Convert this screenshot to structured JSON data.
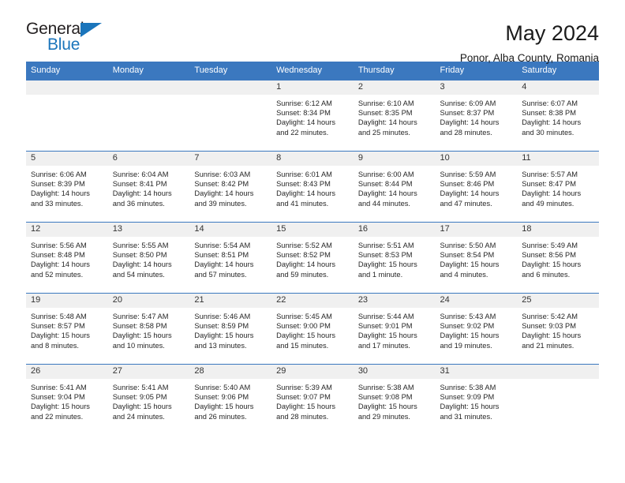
{
  "brand": {
    "name_top": "General",
    "name_bottom": "Blue",
    "accent_color": "#1b75bb"
  },
  "header": {
    "title": "May 2024",
    "subtitle": "Ponor, Alba County, Romania"
  },
  "theme": {
    "header_row_bg": "#3b78bf",
    "daynum_bg": "#f0f0f0",
    "grid_line": "#3b78bf",
    "text": "#262626"
  },
  "weekday_headers": [
    "Sunday",
    "Monday",
    "Tuesday",
    "Wednesday",
    "Thursday",
    "Friday",
    "Saturday"
  ],
  "weeks": [
    [
      {
        "day": "",
        "sunrise": "",
        "sunset": "",
        "daylight_line1": "",
        "daylight_line2": ""
      },
      {
        "day": "",
        "sunrise": "",
        "sunset": "",
        "daylight_line1": "",
        "daylight_line2": ""
      },
      {
        "day": "",
        "sunrise": "",
        "sunset": "",
        "daylight_line1": "",
        "daylight_line2": ""
      },
      {
        "day": "1",
        "sunrise": "Sunrise: 6:12 AM",
        "sunset": "Sunset: 8:34 PM",
        "daylight_line1": "Daylight: 14 hours",
        "daylight_line2": "and 22 minutes."
      },
      {
        "day": "2",
        "sunrise": "Sunrise: 6:10 AM",
        "sunset": "Sunset: 8:35 PM",
        "daylight_line1": "Daylight: 14 hours",
        "daylight_line2": "and 25 minutes."
      },
      {
        "day": "3",
        "sunrise": "Sunrise: 6:09 AM",
        "sunset": "Sunset: 8:37 PM",
        "daylight_line1": "Daylight: 14 hours",
        "daylight_line2": "and 28 minutes."
      },
      {
        "day": "4",
        "sunrise": "Sunrise: 6:07 AM",
        "sunset": "Sunset: 8:38 PM",
        "daylight_line1": "Daylight: 14 hours",
        "daylight_line2": "and 30 minutes."
      }
    ],
    [
      {
        "day": "5",
        "sunrise": "Sunrise: 6:06 AM",
        "sunset": "Sunset: 8:39 PM",
        "daylight_line1": "Daylight: 14 hours",
        "daylight_line2": "and 33 minutes."
      },
      {
        "day": "6",
        "sunrise": "Sunrise: 6:04 AM",
        "sunset": "Sunset: 8:41 PM",
        "daylight_line1": "Daylight: 14 hours",
        "daylight_line2": "and 36 minutes."
      },
      {
        "day": "7",
        "sunrise": "Sunrise: 6:03 AM",
        "sunset": "Sunset: 8:42 PM",
        "daylight_line1": "Daylight: 14 hours",
        "daylight_line2": "and 39 minutes."
      },
      {
        "day": "8",
        "sunrise": "Sunrise: 6:01 AM",
        "sunset": "Sunset: 8:43 PM",
        "daylight_line1": "Daylight: 14 hours",
        "daylight_line2": "and 41 minutes."
      },
      {
        "day": "9",
        "sunrise": "Sunrise: 6:00 AM",
        "sunset": "Sunset: 8:44 PM",
        "daylight_line1": "Daylight: 14 hours",
        "daylight_line2": "and 44 minutes."
      },
      {
        "day": "10",
        "sunrise": "Sunrise: 5:59 AM",
        "sunset": "Sunset: 8:46 PM",
        "daylight_line1": "Daylight: 14 hours",
        "daylight_line2": "and 47 minutes."
      },
      {
        "day": "11",
        "sunrise": "Sunrise: 5:57 AM",
        "sunset": "Sunset: 8:47 PM",
        "daylight_line1": "Daylight: 14 hours",
        "daylight_line2": "and 49 minutes."
      }
    ],
    [
      {
        "day": "12",
        "sunrise": "Sunrise: 5:56 AM",
        "sunset": "Sunset: 8:48 PM",
        "daylight_line1": "Daylight: 14 hours",
        "daylight_line2": "and 52 minutes."
      },
      {
        "day": "13",
        "sunrise": "Sunrise: 5:55 AM",
        "sunset": "Sunset: 8:50 PM",
        "daylight_line1": "Daylight: 14 hours",
        "daylight_line2": "and 54 minutes."
      },
      {
        "day": "14",
        "sunrise": "Sunrise: 5:54 AM",
        "sunset": "Sunset: 8:51 PM",
        "daylight_line1": "Daylight: 14 hours",
        "daylight_line2": "and 57 minutes."
      },
      {
        "day": "15",
        "sunrise": "Sunrise: 5:52 AM",
        "sunset": "Sunset: 8:52 PM",
        "daylight_line1": "Daylight: 14 hours",
        "daylight_line2": "and 59 minutes."
      },
      {
        "day": "16",
        "sunrise": "Sunrise: 5:51 AM",
        "sunset": "Sunset: 8:53 PM",
        "daylight_line1": "Daylight: 15 hours",
        "daylight_line2": "and 1 minute."
      },
      {
        "day": "17",
        "sunrise": "Sunrise: 5:50 AM",
        "sunset": "Sunset: 8:54 PM",
        "daylight_line1": "Daylight: 15 hours",
        "daylight_line2": "and 4 minutes."
      },
      {
        "day": "18",
        "sunrise": "Sunrise: 5:49 AM",
        "sunset": "Sunset: 8:56 PM",
        "daylight_line1": "Daylight: 15 hours",
        "daylight_line2": "and 6 minutes."
      }
    ],
    [
      {
        "day": "19",
        "sunrise": "Sunrise: 5:48 AM",
        "sunset": "Sunset: 8:57 PM",
        "daylight_line1": "Daylight: 15 hours",
        "daylight_line2": "and 8 minutes."
      },
      {
        "day": "20",
        "sunrise": "Sunrise: 5:47 AM",
        "sunset": "Sunset: 8:58 PM",
        "daylight_line1": "Daylight: 15 hours",
        "daylight_line2": "and 10 minutes."
      },
      {
        "day": "21",
        "sunrise": "Sunrise: 5:46 AM",
        "sunset": "Sunset: 8:59 PM",
        "daylight_line1": "Daylight: 15 hours",
        "daylight_line2": "and 13 minutes."
      },
      {
        "day": "22",
        "sunrise": "Sunrise: 5:45 AM",
        "sunset": "Sunset: 9:00 PM",
        "daylight_line1": "Daylight: 15 hours",
        "daylight_line2": "and 15 minutes."
      },
      {
        "day": "23",
        "sunrise": "Sunrise: 5:44 AM",
        "sunset": "Sunset: 9:01 PM",
        "daylight_line1": "Daylight: 15 hours",
        "daylight_line2": "and 17 minutes."
      },
      {
        "day": "24",
        "sunrise": "Sunrise: 5:43 AM",
        "sunset": "Sunset: 9:02 PM",
        "daylight_line1": "Daylight: 15 hours",
        "daylight_line2": "and 19 minutes."
      },
      {
        "day": "25",
        "sunrise": "Sunrise: 5:42 AM",
        "sunset": "Sunset: 9:03 PM",
        "daylight_line1": "Daylight: 15 hours",
        "daylight_line2": "and 21 minutes."
      }
    ],
    [
      {
        "day": "26",
        "sunrise": "Sunrise: 5:41 AM",
        "sunset": "Sunset: 9:04 PM",
        "daylight_line1": "Daylight: 15 hours",
        "daylight_line2": "and 22 minutes."
      },
      {
        "day": "27",
        "sunrise": "Sunrise: 5:41 AM",
        "sunset": "Sunset: 9:05 PM",
        "daylight_line1": "Daylight: 15 hours",
        "daylight_line2": "and 24 minutes."
      },
      {
        "day": "28",
        "sunrise": "Sunrise: 5:40 AM",
        "sunset": "Sunset: 9:06 PM",
        "daylight_line1": "Daylight: 15 hours",
        "daylight_line2": "and 26 minutes."
      },
      {
        "day": "29",
        "sunrise": "Sunrise: 5:39 AM",
        "sunset": "Sunset: 9:07 PM",
        "daylight_line1": "Daylight: 15 hours",
        "daylight_line2": "and 28 minutes."
      },
      {
        "day": "30",
        "sunrise": "Sunrise: 5:38 AM",
        "sunset": "Sunset: 9:08 PM",
        "daylight_line1": "Daylight: 15 hours",
        "daylight_line2": "and 29 minutes."
      },
      {
        "day": "31",
        "sunrise": "Sunrise: 5:38 AM",
        "sunset": "Sunset: 9:09 PM",
        "daylight_line1": "Daylight: 15 hours",
        "daylight_line2": "and 31 minutes."
      },
      {
        "day": "",
        "sunrise": "",
        "sunset": "",
        "daylight_line1": "",
        "daylight_line2": ""
      }
    ]
  ]
}
